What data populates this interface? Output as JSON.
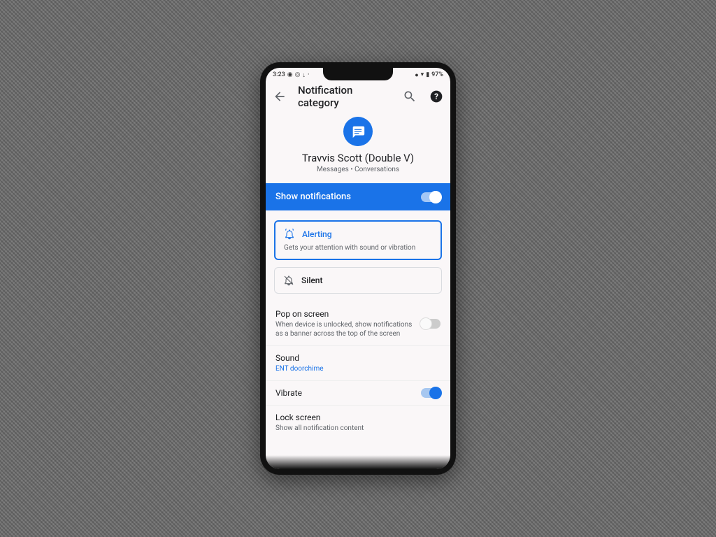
{
  "statusbar": {
    "time": "3:23",
    "battery": "97%"
  },
  "appbar": {
    "title": "Notification category"
  },
  "hero": {
    "contact_name": "Travvis Scott (Double V)",
    "subcategory": "Messages • Conversations"
  },
  "show_notifications": {
    "label": "Show notifications",
    "enabled": true
  },
  "options": {
    "alerting": {
      "label": "Alerting",
      "description": "Gets your attention with sound or vibration",
      "selected": true
    },
    "silent": {
      "label": "Silent",
      "selected": false
    }
  },
  "settings": {
    "pop_on_screen": {
      "title": "Pop on screen",
      "subtitle": "When device is unlocked, show notifications as a banner across the top of the screen",
      "enabled": false
    },
    "sound": {
      "title": "Sound",
      "value": "ENT doorchime"
    },
    "vibrate": {
      "title": "Vibrate",
      "enabled": true
    },
    "lock_screen": {
      "title": "Lock screen",
      "value": "Show all notification content"
    }
  }
}
